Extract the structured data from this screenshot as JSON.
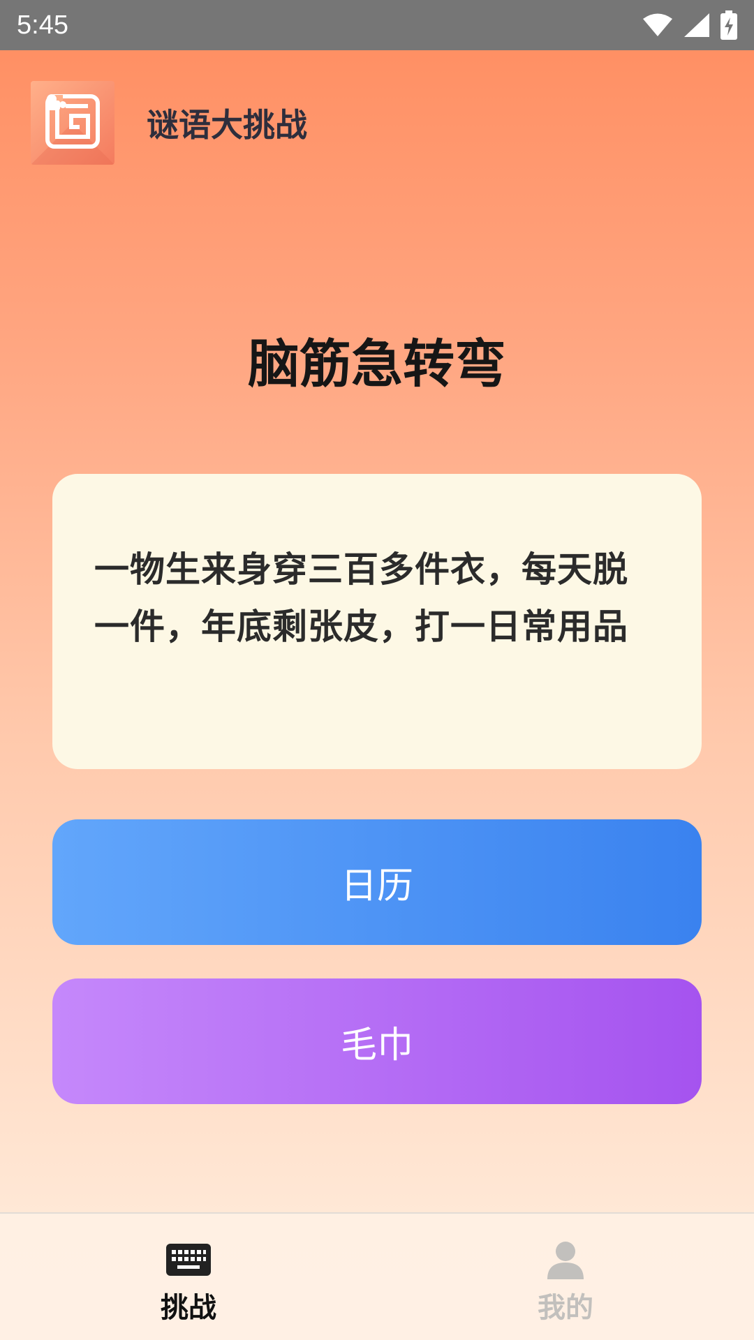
{
  "status_bar": {
    "time": "5:45",
    "icons": [
      "wifi-icon",
      "signal-icon",
      "battery-charging-icon"
    ]
  },
  "app": {
    "title": "谜语大挑战",
    "logo_icon": "puzzle-maze-icon"
  },
  "page": {
    "title": "脑筋急转弯"
  },
  "riddle": {
    "text": "一物生来身穿三百多件衣，每天脱一件，年底剩张皮，打一日常用品"
  },
  "answers": [
    {
      "label": "日历",
      "color_start": "#62a6fb",
      "color_end": "#3a82ef"
    },
    {
      "label": "毛巾",
      "color_start": "#c588fb",
      "color_end": "#a553ef"
    }
  ],
  "tabs": [
    {
      "label": "挑战",
      "icon": "keyboard-icon",
      "active": true
    },
    {
      "label": "我的",
      "icon": "person-icon",
      "active": false
    }
  ],
  "colors": {
    "background_top": "#ff8c5f",
    "background_bottom": "#fff0e2",
    "card": "#fdf8e5",
    "status_bar": "#767676"
  }
}
